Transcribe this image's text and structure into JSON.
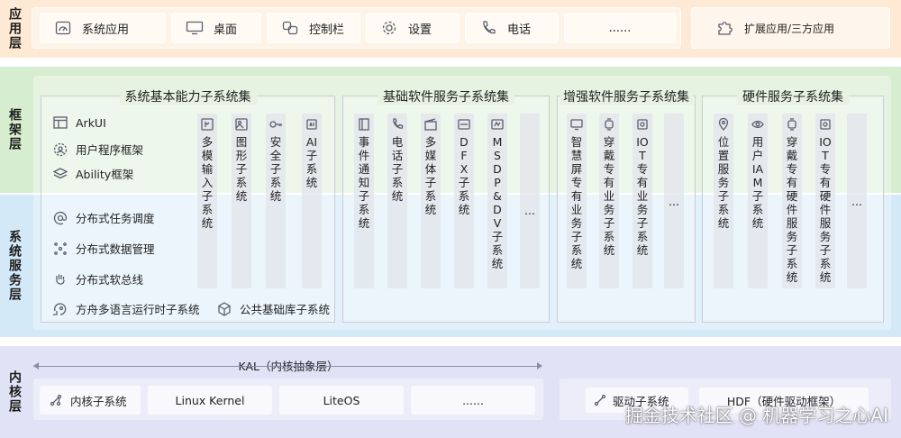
{
  "layers": {
    "app": "应用层",
    "framework": "框架层",
    "system_service": "系统服务层",
    "kernel": "内核层"
  },
  "app_layer": {
    "items": [
      "系统应用",
      "桌面",
      "控制栏",
      "设置",
      "电话",
      "......"
    ],
    "extension": "扩展应用/三方应用"
  },
  "framework_items": [
    "ArkUI",
    "用户程序框架",
    "Ability框架"
  ],
  "basic_capability": {
    "title": "系统基本能力子系统集",
    "items": [
      "分布式任务调度",
      "分布式数据管理",
      "分布式软总线"
    ],
    "ark_runtime": "方舟多语言运行时子系统",
    "common_lib": "公共基础库子系统",
    "columns": [
      "多模输入子系统",
      "图形子系统",
      "安全子系统",
      "AI子系统"
    ]
  },
  "basic_software": {
    "title": "基础软件服务子系统集",
    "columns": [
      "事件通知子系统",
      "电话子系统",
      "多媒体子系统",
      "DFX子系统",
      "MSDP&DV子系统",
      "..."
    ]
  },
  "enhanced_software": {
    "title": "增强软件服务子系统集",
    "columns": [
      "智慧屏专有业务子系统",
      "穿戴专有业务子系统",
      "IOT专有业务子系统",
      "..."
    ]
  },
  "hardware_service": {
    "title": "硬件服务子系统集",
    "columns": [
      "位置服务子系统",
      "用户IAM子系统",
      "穿戴专有硬件服务子系统",
      "IOT专有硬件服务子系统",
      "..."
    ]
  },
  "kernel_layer": {
    "kal": "KAL（内核抽象层）",
    "kernel_subsystem": "内核子系统",
    "kernels": [
      "Linux Kernel",
      "LiteOS",
      "......"
    ],
    "driver_subsystem": "驱动子系统",
    "hdf": "HDF（硬件驱动框架）"
  },
  "watermark": "掘金技术社区 @ 机器学习之心AI",
  "colors": {
    "app_band": "#fde9d4",
    "framework_band": "#d7edcf",
    "system_band": "#d3e9f7",
    "kernel_band": "#e2e2f6"
  }
}
